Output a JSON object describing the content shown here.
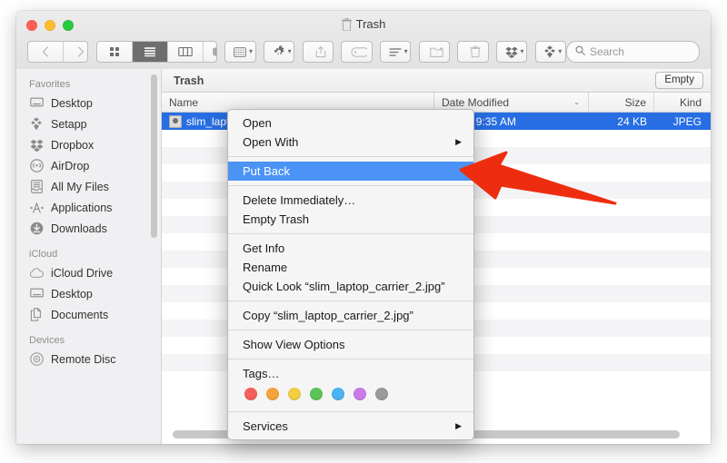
{
  "window": {
    "title": "Trash",
    "title_icon": "trash-icon",
    "traffic_lights": [
      {
        "name": "close-button",
        "color": "#ff5f57"
      },
      {
        "name": "minimize-button",
        "color": "#febc2e"
      },
      {
        "name": "maximize-button",
        "color": "#28c840"
      }
    ]
  },
  "toolbar": {
    "back_label": "‹",
    "forward_label": "›",
    "view_icon_label": "icon-view",
    "view_list_label": "list-view",
    "view_column_label": "column-view",
    "view_cover_label": "coverflow-view",
    "arrange_label": "arrange",
    "action_label": "action-gear",
    "share_label": "share",
    "tags_label": "tags",
    "sort_label": "sort",
    "newfolder_label": "new-folder",
    "delete_label": "delete",
    "dropbox_label": "dropbox",
    "setapp_label": "setapp",
    "search_placeholder": "Search"
  },
  "sidebar": {
    "sections": [
      {
        "header": "Favorites",
        "items": [
          {
            "label": "Desktop",
            "icon": "desktop-icon"
          },
          {
            "label": "Setapp",
            "icon": "setapp-icon"
          },
          {
            "label": "Dropbox",
            "icon": "dropbox-icon"
          },
          {
            "label": "AirDrop",
            "icon": "airdrop-icon"
          },
          {
            "label": "All My Files",
            "icon": "all-my-files-icon"
          },
          {
            "label": "Applications",
            "icon": "applications-icon"
          },
          {
            "label": "Downloads",
            "icon": "downloads-icon"
          }
        ]
      },
      {
        "header": "iCloud",
        "items": [
          {
            "label": "iCloud Drive",
            "icon": "cloud-icon"
          },
          {
            "label": "Desktop",
            "icon": "desktop-icon"
          },
          {
            "label": "Documents",
            "icon": "documents-icon"
          }
        ]
      },
      {
        "header": "Devices",
        "items": [
          {
            "label": "Remote Disc",
            "icon": "disc-icon"
          }
        ]
      }
    ]
  },
  "main": {
    "path_title": "Trash",
    "empty_button": "Empty",
    "columns": [
      "Name",
      "Date Modified",
      "Size",
      "Kind"
    ],
    "sort_indicator": "⌄",
    "rows": [
      {
        "name": "slim_laptop_carrier_2.jpg",
        "date": "Today, 9:35 AM",
        "size": "24 KB",
        "kind": "JPEG",
        "selected": true
      }
    ]
  },
  "context_menu": {
    "groups": [
      {
        "items": [
          {
            "label": "Open",
            "submenu": false,
            "highlighted": false
          },
          {
            "label": "Open With",
            "submenu": true,
            "highlighted": false
          }
        ]
      },
      {
        "items": [
          {
            "label": "Put Back",
            "submenu": false,
            "highlighted": true
          }
        ]
      },
      {
        "items": [
          {
            "label": "Delete Immediately…",
            "submenu": false,
            "highlighted": false
          },
          {
            "label": "Empty Trash",
            "submenu": false,
            "highlighted": false
          }
        ]
      },
      {
        "items": [
          {
            "label": "Get Info",
            "submenu": false,
            "highlighted": false
          },
          {
            "label": "Rename",
            "submenu": false,
            "highlighted": false
          },
          {
            "label": "Quick Look “slim_laptop_carrier_2.jpg”",
            "submenu": false,
            "highlighted": false
          }
        ]
      },
      {
        "items": [
          {
            "label": "Copy “slim_laptop_carrier_2.jpg”",
            "submenu": false,
            "highlighted": false
          }
        ]
      },
      {
        "items": [
          {
            "label": "Show View Options",
            "submenu": false,
            "highlighted": false
          }
        ]
      },
      {
        "items": [
          {
            "label": "Tags…",
            "submenu": false,
            "highlighted": false
          }
        ],
        "tags": [
          "#f4605d",
          "#f5a33c",
          "#f2ce45",
          "#5cc45a",
          "#4cb4f0",
          "#cc7ae8",
          "#9b9b9b"
        ]
      },
      {
        "items": [
          {
            "label": "Services",
            "submenu": true,
            "highlighted": false
          }
        ]
      }
    ],
    "submenu_arrow": "▶",
    "highlight_color": "#4b93f5"
  },
  "annotation": {
    "arrow_color": "#ee2d10",
    "arrow_name": "red-pointer-arrow",
    "points_to": "Put Back"
  }
}
